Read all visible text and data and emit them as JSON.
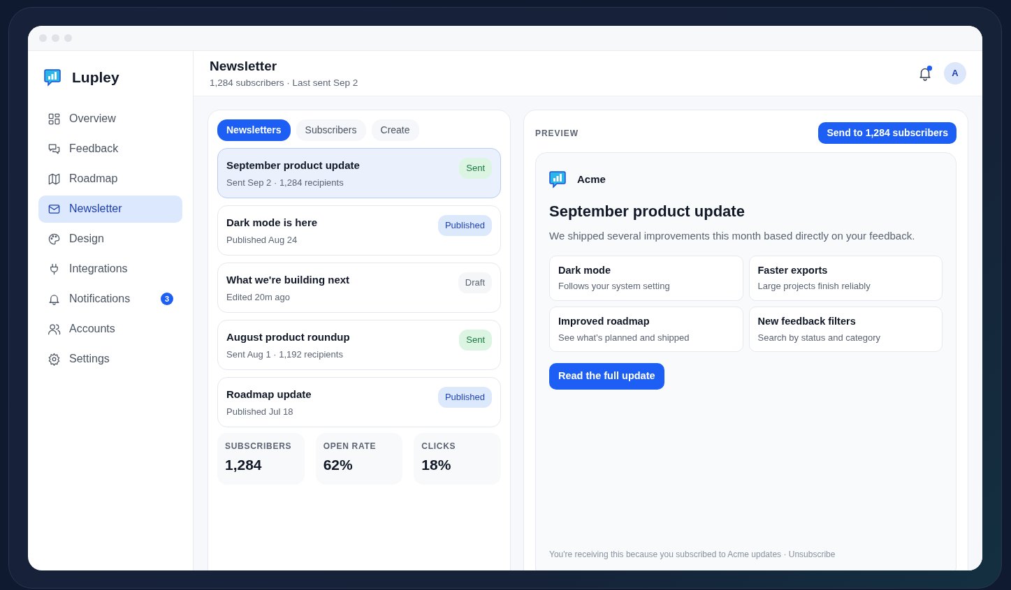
{
  "brand": {
    "name": "Lupley"
  },
  "sidebar": {
    "items": [
      {
        "label": "Overview",
        "selected": false
      },
      {
        "label": "Feedback",
        "selected": false
      },
      {
        "label": "Roadmap",
        "selected": false
      },
      {
        "label": "Newsletter",
        "selected": true
      },
      {
        "label": "Design",
        "selected": false
      },
      {
        "label": "Integrations",
        "selected": false
      },
      {
        "label": "Notifications",
        "selected": false,
        "badge": "3"
      },
      {
        "label": "Accounts",
        "selected": false
      },
      {
        "label": "Settings",
        "selected": false
      }
    ]
  },
  "header": {
    "title": "Newsletter",
    "subtitle": "1,284 subscribers · Last sent Sep 2",
    "unread": true,
    "avatar": "A"
  },
  "tabs": [
    {
      "label": "Newsletters",
      "selected": true
    },
    {
      "label": "Subscribers",
      "selected": false
    },
    {
      "label": "Create",
      "selected": false
    }
  ],
  "newsletters": [
    {
      "title": "September product update",
      "meta": "Sent Sep 2 · 1,284 recipients",
      "status": "Sent",
      "kind": "sent",
      "selected": true
    },
    {
      "title": "Dark mode is here",
      "meta": "Published Aug 24",
      "status": "Published",
      "kind": "published",
      "selected": false
    },
    {
      "title": "What we're building next",
      "meta": "Edited 20m ago",
      "status": "Draft",
      "kind": "draft",
      "selected": false
    },
    {
      "title": "August product roundup",
      "meta": "Sent Aug 1 · 1,192 recipients",
      "status": "Sent",
      "kind": "sent",
      "selected": false
    },
    {
      "title": "Roadmap update",
      "meta": "Published Jul 18",
      "status": "Published",
      "kind": "published",
      "selected": false
    }
  ],
  "stats": [
    {
      "label": "SUBSCRIBERS",
      "value": "1,284"
    },
    {
      "label": "OPEN RATE",
      "value": "62%"
    },
    {
      "label": "CLICKS",
      "value": "18%"
    }
  ],
  "preview": {
    "label": "PREVIEW",
    "send_button": "Send to 1,284 subscribers",
    "brand": "Acme",
    "title": "September product update",
    "intro": "We shipped several improvements this month based directly on your feedback.",
    "features": [
      {
        "title": "Dark mode",
        "description": "Follows your system setting"
      },
      {
        "title": "Faster exports",
        "description": "Large projects finish reliably"
      },
      {
        "title": "Improved roadmap",
        "description": "See what's planned and shipped"
      },
      {
        "title": "New feedback filters",
        "description": "Search by status and category"
      }
    ],
    "cta": "Read the full update",
    "footer": "You're receiving this because you subscribed to Acme updates · Unsubscribe"
  }
}
